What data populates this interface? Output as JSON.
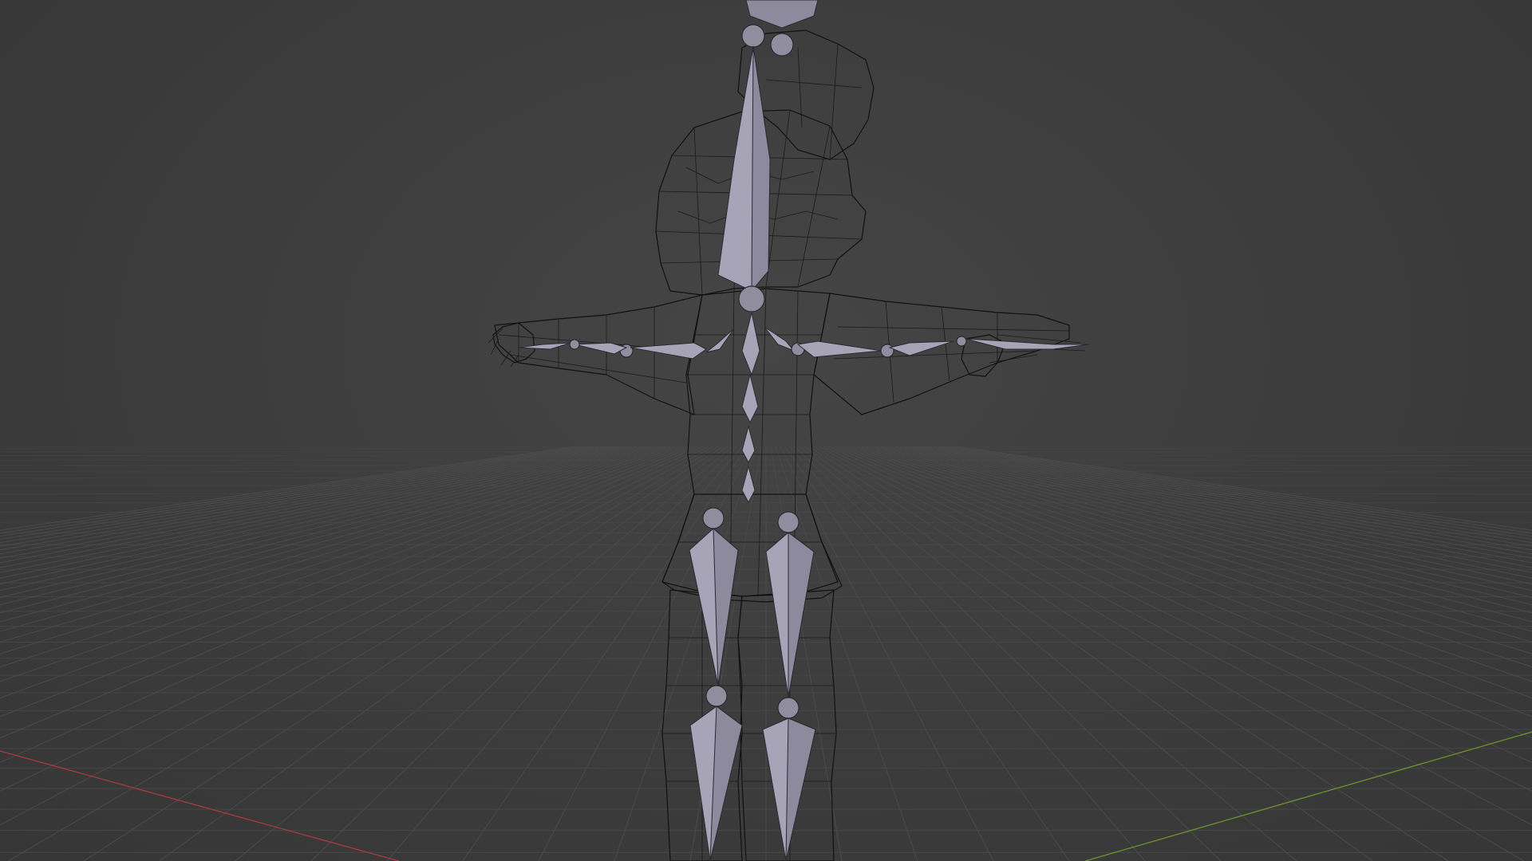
{
  "viewport": {
    "mode": "wireframe",
    "colors": {
      "background": "#3c3c3c",
      "grid": "#4a4a4a",
      "x_axis": "#a23a3f",
      "y_axis": "#6c8f2c",
      "bone_fill": "#8c8a9c",
      "mesh_wire": "#111111"
    },
    "objects": [
      {
        "name": "character-mesh",
        "type": "mesh"
      },
      {
        "name": "armature",
        "type": "armature"
      }
    ]
  }
}
